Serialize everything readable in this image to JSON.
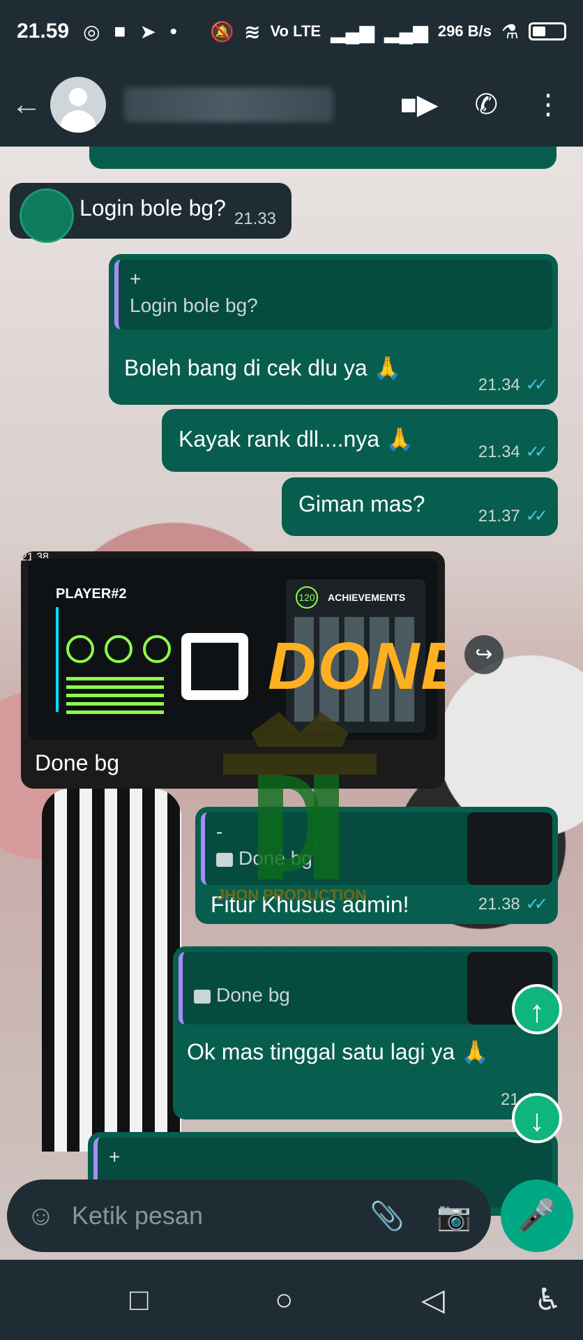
{
  "status_bar": {
    "time": "21.59",
    "network_label": "Vo LTE",
    "speed": "296 B/s"
  },
  "header": {
    "back_icon": "back-arrow-icon",
    "video_icon": "video-camera-icon",
    "call_icon": "phone-icon",
    "menu_icon": "more-vertical-icon"
  },
  "messages": [
    {
      "dir": "in",
      "text": "Login bole bg?",
      "time": "21.33"
    },
    {
      "dir": "out",
      "quote_title": "+",
      "quote_text": "Login bole bg?",
      "text": "Boleh bang di cek dlu ya 🙏",
      "time": "21.34"
    },
    {
      "dir": "out",
      "text": "Kayak rank dll....nya 🙏",
      "time": "21.34"
    },
    {
      "dir": "out",
      "text": "Giman mas?",
      "time": "21.37"
    },
    {
      "dir": "in",
      "media": true,
      "overlay_text": "DONE",
      "panel_title": "ACHIEVEMENTS",
      "panel_badge": "120",
      "player_label": "PLAYER#2",
      "text": "Done bg",
      "time": "21.38"
    },
    {
      "dir": "out",
      "quote_title": "-",
      "quote_text": "Done bg",
      "text": "Fitur Khusus admin!",
      "time": "21.38"
    },
    {
      "dir": "out",
      "quote_text": "Done bg",
      "text": "Ok mas tinggal satu lagi ya 🙏",
      "time": "21.41"
    },
    {
      "dir": "out",
      "quote_title": "+"
    }
  ],
  "watermark": "JHON PRODUCTION",
  "composer": {
    "placeholder": "Ketik pesan",
    "emoji_icon": "emoji-icon",
    "attach_icon": "paperclip-icon",
    "camera_icon": "camera-icon",
    "mic_icon": "microphone-icon"
  },
  "nav": {
    "recent": "square-icon",
    "home": "circle-icon",
    "back": "triangle-back-icon",
    "accessibility": "accessibility-icon"
  },
  "colors": {
    "outgoing_bubble": "#075e4f",
    "incoming_bubble": "#1f2c33",
    "read_ticks": "#53bdeb",
    "accent_green": "#00a884",
    "done_text": "#ffb020"
  }
}
